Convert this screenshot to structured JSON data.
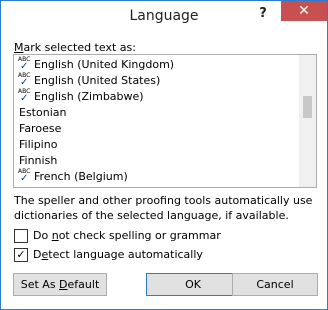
{
  "window": {
    "title": "Language",
    "help_label": "?",
    "close_label": "✕"
  },
  "list": {
    "label_mnemonic": "M",
    "label_rest": "ark selected text as:",
    "items": [
      {
        "label": "English (United Kingdom)",
        "spell_icon": true
      },
      {
        "label": "English (United States)",
        "spell_icon": true
      },
      {
        "label": "English (Zimbabwe)",
        "spell_icon": true
      },
      {
        "label": "Estonian",
        "spell_icon": false
      },
      {
        "label": "Faroese",
        "spell_icon": false
      },
      {
        "label": "Filipino",
        "spell_icon": false
      },
      {
        "label": "Finnish",
        "spell_icon": false
      },
      {
        "label": "French (Belgium)",
        "spell_icon": true
      }
    ],
    "icon_abc": "ABC",
    "icon_check": "✓"
  },
  "description": "The speller and other proofing tools automatically use dictionaries of the selected language, if available.",
  "options": {
    "no_check": {
      "pre": "Do ",
      "mnemonic": "n",
      "post": "ot check spelling or grammar",
      "checked": false
    },
    "detect": {
      "pre": "D",
      "mnemonic": "e",
      "post": "tect language automatically",
      "checked": true,
      "check_glyph": "✓"
    }
  },
  "buttons": {
    "set_default_pre": "Set As ",
    "set_default_mnemonic": "D",
    "set_default_post": "efault",
    "ok": "OK",
    "cancel": "Cancel"
  },
  "colors": {
    "border_accent": "#2b7cd3",
    "close_bg": "#c75050"
  }
}
